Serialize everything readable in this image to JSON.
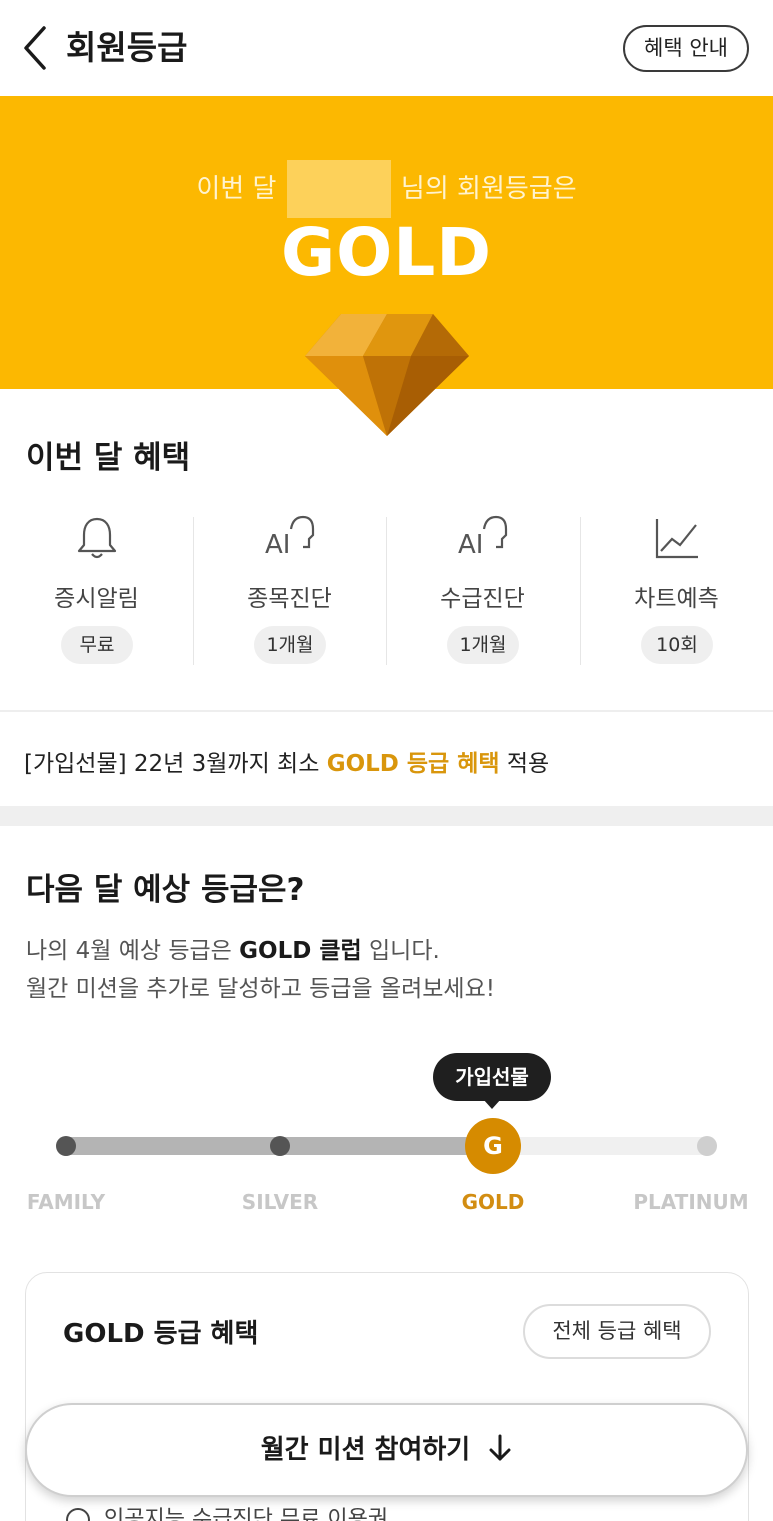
{
  "header": {
    "title": "회원등급",
    "info_button": "혜택 안내"
  },
  "hero": {
    "line_prefix": "이번 달",
    "line_suffix": "님의 회원등급은",
    "grade": "GOLD"
  },
  "this_month": {
    "title": "이번 달 혜택",
    "benefits": [
      {
        "label": "증시알림",
        "chip": "무료",
        "icon": "bell-icon"
      },
      {
        "label": "종목진단",
        "chip": "1개월",
        "icon": "ai-icon"
      },
      {
        "label": "수급진단",
        "chip": "1개월",
        "icon": "ai-icon"
      },
      {
        "label": "차트예측",
        "chip": "10회",
        "icon": "chart-line-icon"
      }
    ]
  },
  "gift": {
    "prefix": "[가입선물] 22년 3월까지 최소 ",
    "highlight": "GOLD 등급 혜택",
    "suffix": " 적용"
  },
  "next_month": {
    "title": "다음 달 예상 등급은?",
    "desc1_prefix": "나의 4월 예상 등급은 ",
    "desc1_bold": "GOLD 클럽",
    "desc1_suffix": " 입니다.",
    "desc2": "월간 미션을 추가로 달성하고 등급을 올려보세요!"
  },
  "progress": {
    "bubble": "가입선물",
    "node_letter": "G",
    "levels": [
      "FAMILY",
      "SILVER",
      "GOLD",
      "PLATINUM"
    ],
    "current_level": "GOLD",
    "accent": "#d68b00"
  },
  "card": {
    "title": "GOLD 등급 혜택",
    "all_button": "전체 등급 혜택",
    "bottom_item": "인공지능 수급진단 무료 이용권"
  },
  "cta": {
    "label": "월간 미션 참여하기"
  },
  "colors": {
    "hero_bg": "#fcb801",
    "gold_text": "#d9960c"
  }
}
